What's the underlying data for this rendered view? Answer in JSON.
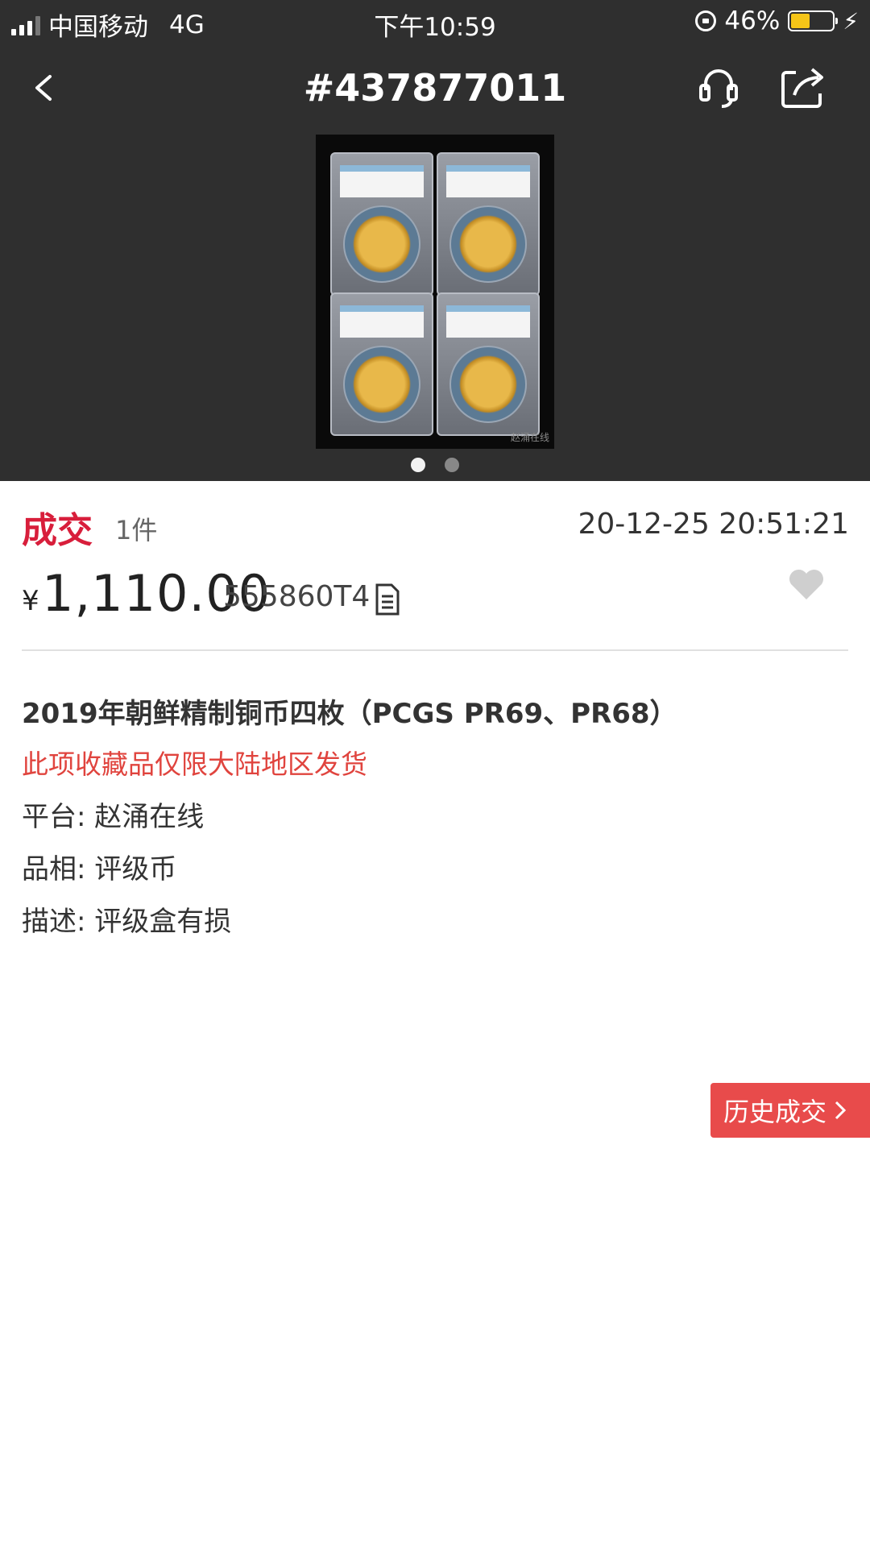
{
  "status_bar": {
    "carrier": "中国移动",
    "network": "4G",
    "time": "下午10:59",
    "battery": "46%",
    "battery_level": 0.46
  },
  "nav": {
    "title": "#437877011",
    "icons": [
      "back-icon",
      "phone-icon",
      "share-icon"
    ]
  },
  "gallery": {
    "image_count": 2,
    "active_index": 0,
    "watermark": "赵涌在线"
  },
  "deal": {
    "status": "成交",
    "quantity": "1件",
    "datetime": "20-12-25 20:51:21",
    "currency": "¥",
    "price": "1,110.00",
    "code": "555860T4"
  },
  "item": {
    "title": "2019年朝鲜精制铜币四枚（PCGS PR69、PR68）",
    "notice": "此项收藏品仅限大陆地区发货",
    "platform": "平台: 赵涌在线",
    "grade": "品相: 评级币",
    "description": "描述: 评级盒有损"
  },
  "history_button": "历史成交",
  "colors": {
    "header_bg": "#2f2f2f",
    "accent_red": "#d81e3b",
    "notice_red": "#e0443e",
    "button_red": "#e84b4b"
  }
}
